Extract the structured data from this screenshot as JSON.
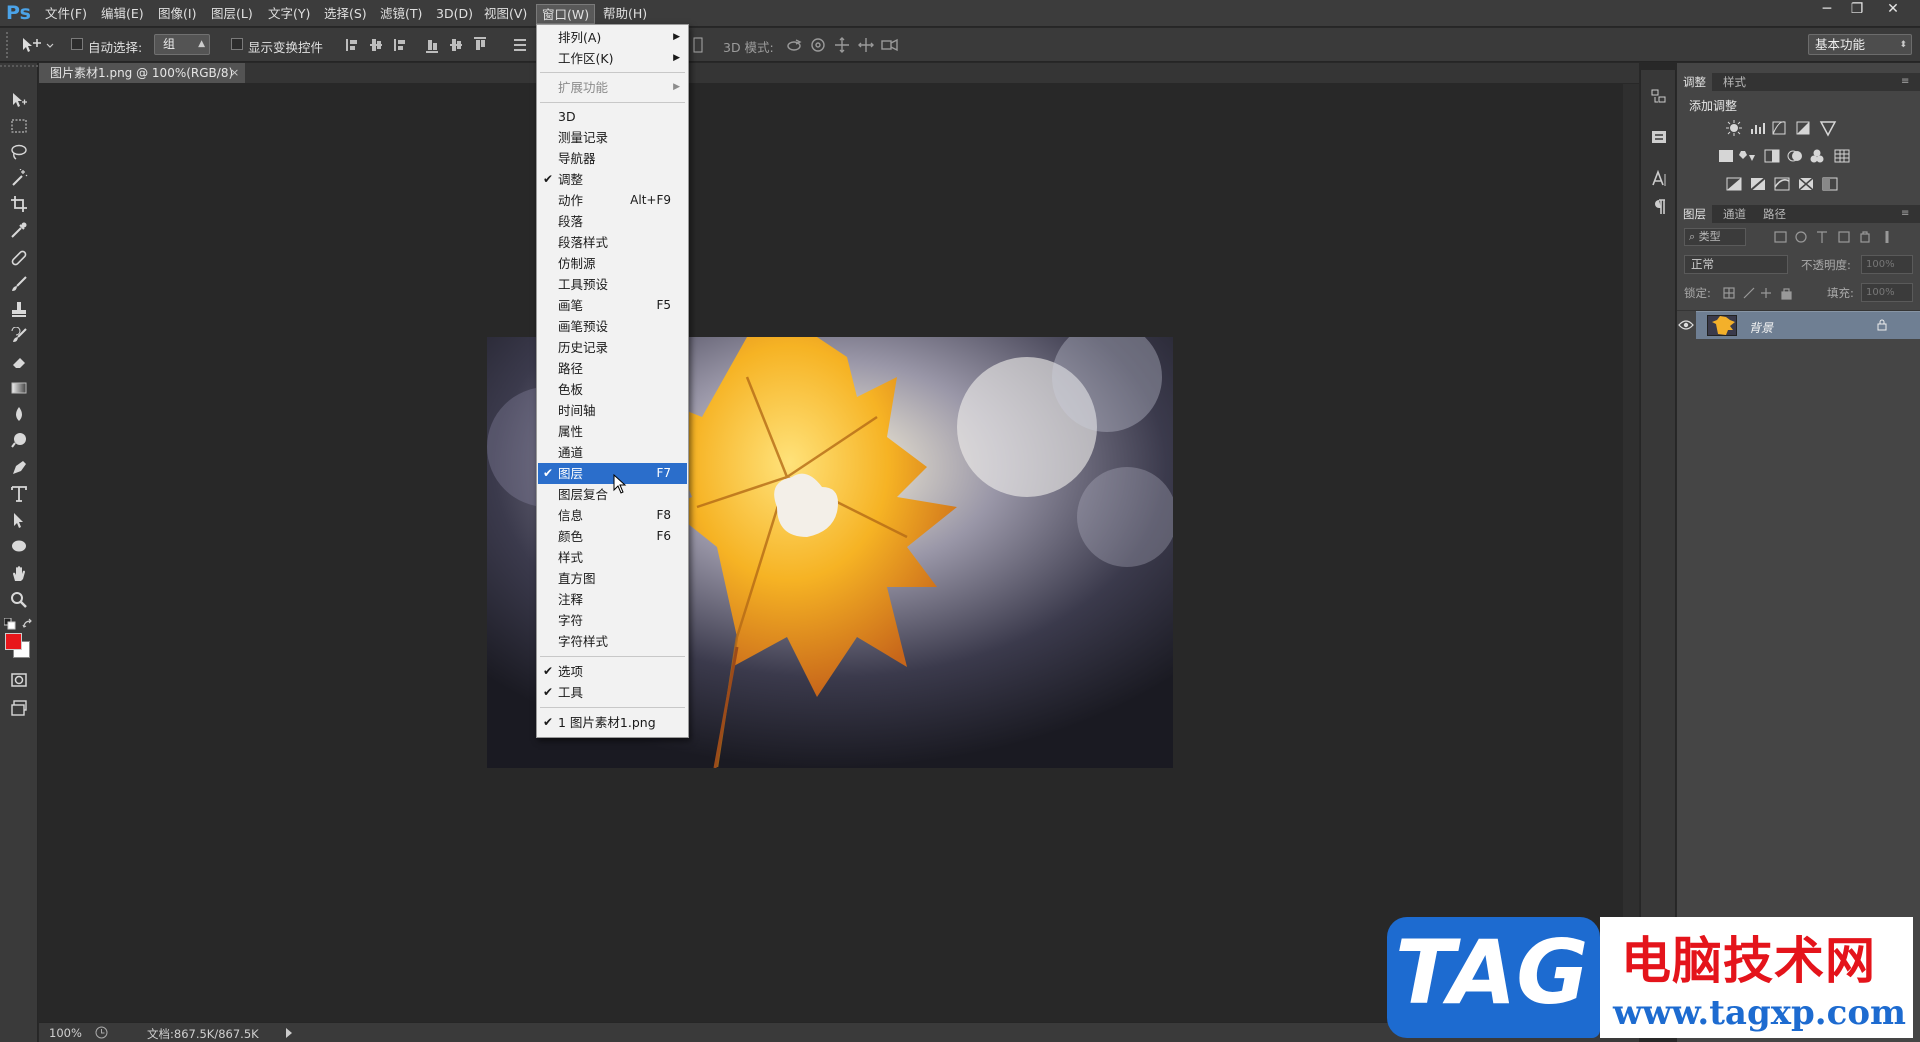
{
  "app": {
    "logo": "Ps"
  },
  "menubar": {
    "items": [
      "文件(F)",
      "编辑(E)",
      "图像(I)",
      "图层(L)",
      "文字(Y)",
      "选择(S)",
      "滤镜(T)",
      "3D(D)",
      "视图(V)",
      "窗口(W)",
      "帮助(H)"
    ],
    "active": "窗口(W)"
  },
  "window_controls": {
    "minimize": "─",
    "restore": "❐",
    "close": "✕"
  },
  "options": {
    "auto_select_label": "自动选择:",
    "auto_select_value": "组",
    "show_transform_label": "显示变换控件",
    "mode_3d_label": "3D 模式:",
    "workspace": "基本功能"
  },
  "document": {
    "tab_title": "图片素材1.png @ 100%(RGB/8)",
    "tab_close": "×"
  },
  "status": {
    "zoom": "100%",
    "doc_info": "文档:867.5K/867.5K"
  },
  "panels": {
    "top_tabs": [
      "调整",
      "样式"
    ],
    "add_adjustment": "添加调整",
    "layer_tabs": [
      "图层",
      "通道",
      "路径"
    ],
    "kind_filter": "类型",
    "blend_mode": "正常",
    "opacity_label": "不透明度:",
    "opacity_value": "100%",
    "lock_label": "锁定:",
    "fill_label": "填充:",
    "fill_value": "100%",
    "layer_name": "背景"
  },
  "window_menu": {
    "items": [
      {
        "label": "排列(A)",
        "submenu": true
      },
      {
        "label": "工作区(K)",
        "submenu": true
      },
      {
        "label": "扩展功能",
        "submenu": true,
        "disabled": true
      },
      {
        "label": "3D"
      },
      {
        "label": "测量记录"
      },
      {
        "label": "导航器"
      },
      {
        "label": "调整",
        "checked": true
      },
      {
        "label": "动作",
        "shortcut": "Alt+F9"
      },
      {
        "label": "段落"
      },
      {
        "label": "段落样式"
      },
      {
        "label": "仿制源"
      },
      {
        "label": "工具预设"
      },
      {
        "label": "画笔",
        "shortcut": "F5"
      },
      {
        "label": "画笔预设"
      },
      {
        "label": "历史记录"
      },
      {
        "label": "路径"
      },
      {
        "label": "色板"
      },
      {
        "label": "时间轴"
      },
      {
        "label": "属性"
      },
      {
        "label": "通道"
      },
      {
        "label": "图层",
        "shortcut": "F7",
        "checked": true,
        "highlight": true
      },
      {
        "label": "图层复合"
      },
      {
        "label": "信息",
        "shortcut": "F8"
      },
      {
        "label": "颜色",
        "shortcut": "F6"
      },
      {
        "label": "样式"
      },
      {
        "label": "直方图"
      },
      {
        "label": "注释"
      },
      {
        "label": "字符"
      },
      {
        "label": "字符样式"
      },
      {
        "label": "选项",
        "checked": true
      },
      {
        "label": "工具",
        "checked": true
      },
      {
        "label": "1 图片素材1.png",
        "checked": true
      }
    ],
    "check_glyph": "✔",
    "submenu_glyph": "▶"
  },
  "watermark": {
    "tag": "TAG",
    "title": "电脑技术网",
    "url": "www.tagxp.com"
  },
  "colors": {
    "accent": "#2b6ecb",
    "foreground_swatch": "#e8161b",
    "background_swatch": "#ffffff",
    "ps_blue": "#4ba3e8"
  }
}
